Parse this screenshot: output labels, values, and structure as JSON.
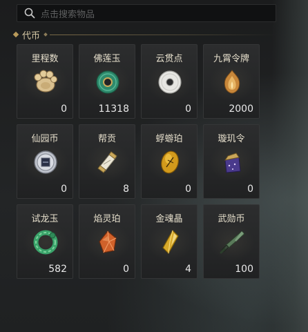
{
  "search": {
    "placeholder": "点击搜索物品"
  },
  "section": {
    "title": "代币"
  },
  "items": [
    {
      "name": "里程数",
      "count": "0",
      "icon": "paw-token-icon"
    },
    {
      "name": "佛莲玉",
      "count": "11318",
      "icon": "jade-ring-icon"
    },
    {
      "name": "云贯点",
      "count": "0",
      "icon": "white-disc-icon"
    },
    {
      "name": "九霄令牌",
      "count": "2000",
      "icon": "flame-emblem-icon"
    },
    {
      "name": "仙园币",
      "count": "0",
      "icon": "silver-coin-icon"
    },
    {
      "name": "帮贡",
      "count": "8",
      "icon": "scroll-badge-icon"
    },
    {
      "name": "蜉蝣珀",
      "count": "0",
      "icon": "amber-insect-icon"
    },
    {
      "name": "璇玑令",
      "count": "0",
      "icon": "purple-pouch-icon"
    },
    {
      "name": "试龙玉",
      "count": "582",
      "icon": "green-dragon-jade-icon"
    },
    {
      "name": "焰灵珀",
      "count": "0",
      "icon": "orange-crystal-icon"
    },
    {
      "name": "金魂晶",
      "count": "4",
      "icon": "gold-crystal-icon"
    },
    {
      "name": "武勋币",
      "count": "100",
      "icon": "green-blade-icon"
    }
  ]
}
